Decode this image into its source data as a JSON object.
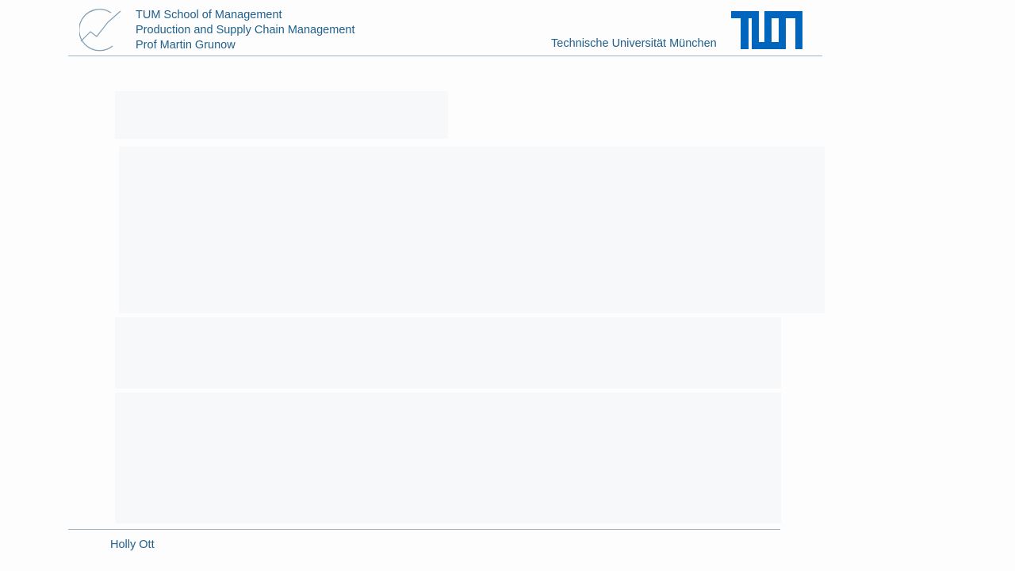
{
  "header": {
    "school": "TUM School of Management",
    "chair": "Production and Supply Chain Management",
    "professor": "Prof Martin Grunow",
    "university": "Technische Universität München"
  },
  "footer": {
    "author": "Holly Ott"
  },
  "colors": {
    "brand_blue": "#1f5f8b",
    "tum_blue": "#0065bd",
    "rule": "#9fb6c7"
  },
  "icons": {
    "chair_logo": "chart-trend-logo",
    "university_logo": "tum-logo"
  }
}
